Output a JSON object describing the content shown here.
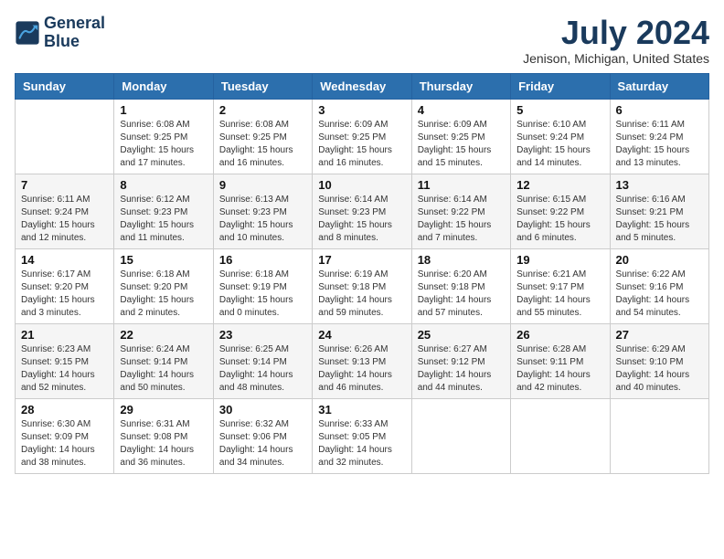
{
  "header": {
    "logo_line1": "General",
    "logo_line2": "Blue",
    "month": "July 2024",
    "location": "Jenison, Michigan, United States"
  },
  "weekdays": [
    "Sunday",
    "Monday",
    "Tuesday",
    "Wednesday",
    "Thursday",
    "Friday",
    "Saturday"
  ],
  "weeks": [
    [
      {
        "day": "",
        "sunrise": "",
        "sunset": "",
        "daylight": ""
      },
      {
        "day": "1",
        "sunrise": "6:08 AM",
        "sunset": "9:25 PM",
        "daylight": "15 hours and 17 minutes."
      },
      {
        "day": "2",
        "sunrise": "6:08 AM",
        "sunset": "9:25 PM",
        "daylight": "15 hours and 16 minutes."
      },
      {
        "day": "3",
        "sunrise": "6:09 AM",
        "sunset": "9:25 PM",
        "daylight": "15 hours and 16 minutes."
      },
      {
        "day": "4",
        "sunrise": "6:09 AM",
        "sunset": "9:25 PM",
        "daylight": "15 hours and 15 minutes."
      },
      {
        "day": "5",
        "sunrise": "6:10 AM",
        "sunset": "9:24 PM",
        "daylight": "15 hours and 14 minutes."
      },
      {
        "day": "6",
        "sunrise": "6:11 AM",
        "sunset": "9:24 PM",
        "daylight": "15 hours and 13 minutes."
      }
    ],
    [
      {
        "day": "7",
        "sunrise": "6:11 AM",
        "sunset": "9:24 PM",
        "daylight": "15 hours and 12 minutes."
      },
      {
        "day": "8",
        "sunrise": "6:12 AM",
        "sunset": "9:23 PM",
        "daylight": "15 hours and 11 minutes."
      },
      {
        "day": "9",
        "sunrise": "6:13 AM",
        "sunset": "9:23 PM",
        "daylight": "15 hours and 10 minutes."
      },
      {
        "day": "10",
        "sunrise": "6:14 AM",
        "sunset": "9:23 PM",
        "daylight": "15 hours and 8 minutes."
      },
      {
        "day": "11",
        "sunrise": "6:14 AM",
        "sunset": "9:22 PM",
        "daylight": "15 hours and 7 minutes."
      },
      {
        "day": "12",
        "sunrise": "6:15 AM",
        "sunset": "9:22 PM",
        "daylight": "15 hours and 6 minutes."
      },
      {
        "day": "13",
        "sunrise": "6:16 AM",
        "sunset": "9:21 PM",
        "daylight": "15 hours and 5 minutes."
      }
    ],
    [
      {
        "day": "14",
        "sunrise": "6:17 AM",
        "sunset": "9:20 PM",
        "daylight": "15 hours and 3 minutes."
      },
      {
        "day": "15",
        "sunrise": "6:18 AM",
        "sunset": "9:20 PM",
        "daylight": "15 hours and 2 minutes."
      },
      {
        "day": "16",
        "sunrise": "6:18 AM",
        "sunset": "9:19 PM",
        "daylight": "15 hours and 0 minutes."
      },
      {
        "day": "17",
        "sunrise": "6:19 AM",
        "sunset": "9:18 PM",
        "daylight": "14 hours and 59 minutes."
      },
      {
        "day": "18",
        "sunrise": "6:20 AM",
        "sunset": "9:18 PM",
        "daylight": "14 hours and 57 minutes."
      },
      {
        "day": "19",
        "sunrise": "6:21 AM",
        "sunset": "9:17 PM",
        "daylight": "14 hours and 55 minutes."
      },
      {
        "day": "20",
        "sunrise": "6:22 AM",
        "sunset": "9:16 PM",
        "daylight": "14 hours and 54 minutes."
      }
    ],
    [
      {
        "day": "21",
        "sunrise": "6:23 AM",
        "sunset": "9:15 PM",
        "daylight": "14 hours and 52 minutes."
      },
      {
        "day": "22",
        "sunrise": "6:24 AM",
        "sunset": "9:14 PM",
        "daylight": "14 hours and 50 minutes."
      },
      {
        "day": "23",
        "sunrise": "6:25 AM",
        "sunset": "9:14 PM",
        "daylight": "14 hours and 48 minutes."
      },
      {
        "day": "24",
        "sunrise": "6:26 AM",
        "sunset": "9:13 PM",
        "daylight": "14 hours and 46 minutes."
      },
      {
        "day": "25",
        "sunrise": "6:27 AM",
        "sunset": "9:12 PM",
        "daylight": "14 hours and 44 minutes."
      },
      {
        "day": "26",
        "sunrise": "6:28 AM",
        "sunset": "9:11 PM",
        "daylight": "14 hours and 42 minutes."
      },
      {
        "day": "27",
        "sunrise": "6:29 AM",
        "sunset": "9:10 PM",
        "daylight": "14 hours and 40 minutes."
      }
    ],
    [
      {
        "day": "28",
        "sunrise": "6:30 AM",
        "sunset": "9:09 PM",
        "daylight": "14 hours and 38 minutes."
      },
      {
        "day": "29",
        "sunrise": "6:31 AM",
        "sunset": "9:08 PM",
        "daylight": "14 hours and 36 minutes."
      },
      {
        "day": "30",
        "sunrise": "6:32 AM",
        "sunset": "9:06 PM",
        "daylight": "14 hours and 34 minutes."
      },
      {
        "day": "31",
        "sunrise": "6:33 AM",
        "sunset": "9:05 PM",
        "daylight": "14 hours and 32 minutes."
      },
      {
        "day": "",
        "sunrise": "",
        "sunset": "",
        "daylight": ""
      },
      {
        "day": "",
        "sunrise": "",
        "sunset": "",
        "daylight": ""
      },
      {
        "day": "",
        "sunrise": "",
        "sunset": "",
        "daylight": ""
      }
    ]
  ]
}
